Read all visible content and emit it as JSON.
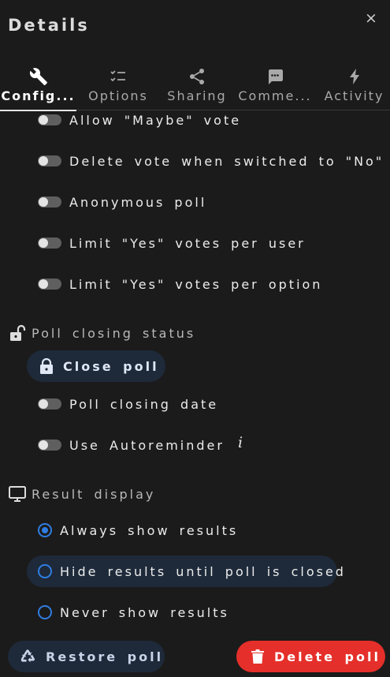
{
  "header": {
    "title": "Details",
    "close_glyph": "×"
  },
  "tabs": [
    {
      "label": "Config...",
      "icon": "wrench-icon",
      "active": true
    },
    {
      "label": "Options",
      "icon": "checklist-icon",
      "active": false
    },
    {
      "label": "Sharing",
      "icon": "share-icon",
      "active": false
    },
    {
      "label": "Comme...",
      "icon": "comment-icon",
      "active": false
    },
    {
      "label": "Activity",
      "icon": "lightning-icon",
      "active": false
    }
  ],
  "toggles": [
    {
      "label": "Allow \"Maybe\" vote",
      "on": false
    },
    {
      "label": "Delete vote when switched to \"No\"",
      "on": false
    },
    {
      "label": "Anonymous poll",
      "on": false
    },
    {
      "label": "Limit \"Yes\" votes per user",
      "on": false
    },
    {
      "label": "Limit \"Yes\" votes per option",
      "on": false
    }
  ],
  "closing": {
    "heading": "Poll closing status",
    "heading_icon": "unlock-icon",
    "close_button": "Close poll",
    "close_button_icon": "lock-icon",
    "closing_date_label": "Poll closing date",
    "autoreminder_label": "Use Autoreminder",
    "info_glyph": "i"
  },
  "result_display": {
    "heading": "Result display",
    "heading_icon": "monitor-icon",
    "options": [
      {
        "label": "Always show results",
        "selected": true
      },
      {
        "label": "Hide results until poll is closed",
        "selected": false
      },
      {
        "label": "Never show results",
        "selected": false
      }
    ]
  },
  "footer": {
    "restore_label": "Restore poll",
    "restore_icon": "recycle-icon",
    "delete_label": "Delete poll",
    "delete_icon": "trash-icon"
  },
  "colors": {
    "background": "#1b1b1b",
    "accent": "#2f7de1",
    "danger": "#e52f2a",
    "pill": "#1e2a3a"
  }
}
